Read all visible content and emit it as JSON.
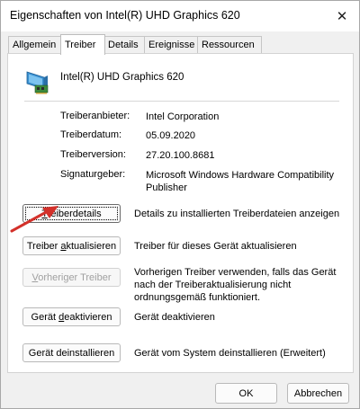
{
  "window": {
    "title": "Eigenschaften von Intel(R) UHD Graphics 620"
  },
  "tabs": [
    {
      "label": "Allgemein"
    },
    {
      "label": "Treiber"
    },
    {
      "label": "Details"
    },
    {
      "label": "Ereignisse"
    },
    {
      "label": "Ressourcen"
    }
  ],
  "device": {
    "name": "Intel(R) UHD Graphics 620",
    "icon": "display-adapter-icon"
  },
  "info": {
    "provider_label": "Treiberanbieter:",
    "provider_value": "Intel Corporation",
    "date_label": "Treiberdatum:",
    "date_value": "05.09.2020",
    "version_label": "Treiberversion:",
    "version_value": "27.20.100.8681",
    "signer_label": "Signaturgeber:",
    "signer_value": "Microsoft Windows Hardware Compatibility Publisher"
  },
  "actions": {
    "details_label_u": "T",
    "details_label_rest": "reiberdetails",
    "details_desc": "Details zu installierten Treiberdateien anzeigen",
    "update_label_pre": "Treiber ",
    "update_label_u": "a",
    "update_label_rest": "ktualisieren",
    "update_desc": "Treiber für dieses Gerät aktualisieren",
    "rollback_label_u": "V",
    "rollback_label_rest": "orheriger Treiber",
    "rollback_desc": "Vorherigen Treiber verwenden, falls das Gerät nach der Treiberaktualisierung nicht ordnungsgemäß funktioniert.",
    "disable_label_pre": "Gerät ",
    "disable_label_u": "d",
    "disable_label_rest": "eaktivieren",
    "disable_desc": "Gerät deaktivieren",
    "uninstall_label": "Gerät deinstallieren",
    "uninstall_desc": "Gerät vom System deinstallieren (Erweitert)"
  },
  "footer": {
    "ok_label": "OK",
    "cancel_label": "Abbrechen"
  },
  "colors": {
    "arrow": "#d3302a",
    "panel_bg": "#ffffff",
    "window_bg": "#f0f0f0"
  }
}
